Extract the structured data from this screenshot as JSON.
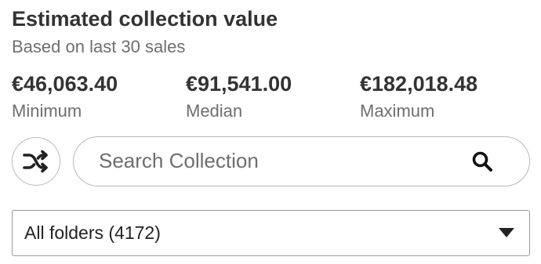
{
  "header": {
    "title": "Estimated collection value",
    "subtitle": "Based on last 30 sales"
  },
  "stats": {
    "minimum": {
      "value": "€46,063.40",
      "label": "Minimum"
    },
    "median": {
      "value": "€91,541.00",
      "label": "Median"
    },
    "maximum": {
      "value": "€182,018.48",
      "label": "Maximum"
    }
  },
  "search": {
    "placeholder": "Search Collection",
    "value": "",
    "icon": "search-icon"
  },
  "shuffle": {
    "icon": "shuffle-icon"
  },
  "folders": {
    "selected": "All folders (4172)",
    "icon": "caret-down-icon"
  },
  "colors": {
    "text_primary": "#333333",
    "text_secondary": "#6e6e6e",
    "border": "#b9b9b9"
  }
}
